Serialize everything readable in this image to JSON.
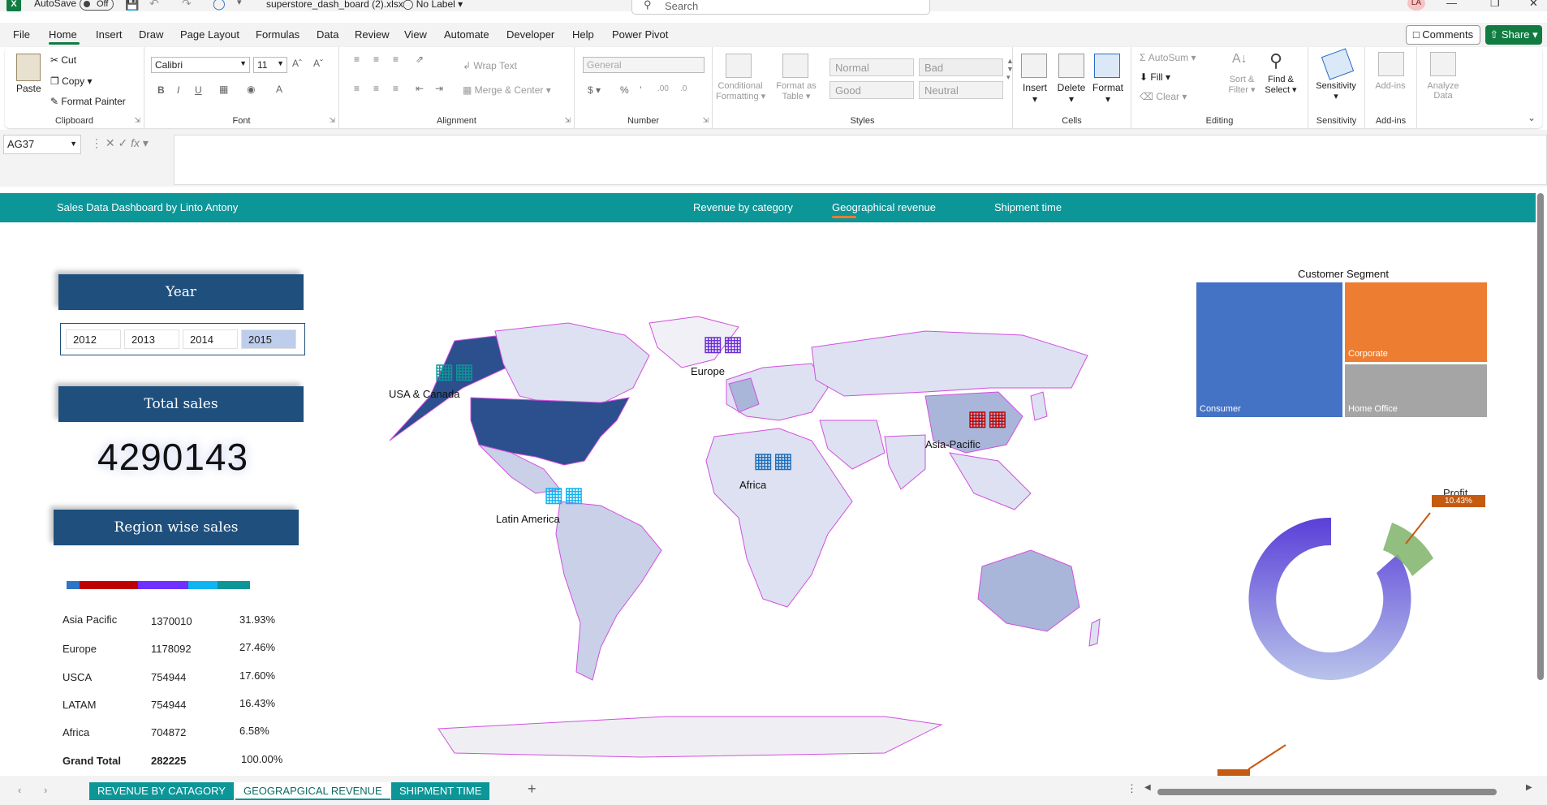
{
  "titlebar": {
    "autosave_label": "AutoSave",
    "autosave_state": "Off",
    "filename": "superstore_dash_board (2).xlsx",
    "sensitivity_label": "No Label",
    "search_placeholder": "Search",
    "user_initials": "LA"
  },
  "menu": {
    "items": [
      "File",
      "Home",
      "Insert",
      "Draw",
      "Page Layout",
      "Formulas",
      "Data",
      "Review",
      "View",
      "Automate",
      "Developer",
      "Help",
      "Power Pivot"
    ],
    "active": "Home",
    "comments": "Comments",
    "share": "Share"
  },
  "ribbon": {
    "clipboard": {
      "paste": "Paste",
      "cut": "Cut",
      "copy": "Copy",
      "format_painter": "Format Painter",
      "label": "Clipboard"
    },
    "font": {
      "name": "Calibri",
      "size": "11",
      "label": "Font"
    },
    "alignment": {
      "wrap": "Wrap Text",
      "merge": "Merge & Center",
      "label": "Alignment"
    },
    "number": {
      "format": "General",
      "label": "Number"
    },
    "styles": {
      "conditional": "Conditional",
      "conditional2": "Formatting",
      "format_as": "Format as",
      "format_as2": "Table",
      "normal": "Normal",
      "bad": "Bad",
      "good": "Good",
      "neutral": "Neutral",
      "label": "Styles"
    },
    "cells": {
      "insert": "Insert",
      "delete": "Delete",
      "format": "Format",
      "label": "Cells"
    },
    "editing": {
      "autosum": "AutoSum",
      "fill": "Fill",
      "clear": "Clear",
      "sort": "Sort &",
      "sort2": "Filter",
      "find": "Find &",
      "find2": "Select",
      "label": "Editing"
    },
    "sensitivity": {
      "btn": "Sensitivity",
      "label": "Sensitivity"
    },
    "addins": {
      "btn": "Add-ins",
      "label": "Add-ins"
    },
    "analyze": {
      "btn": "Analyze",
      "btn2": "Data"
    }
  },
  "formula": {
    "namebox": "AG37",
    "fx": "fx"
  },
  "dashboard": {
    "title": "Sales Data Dashboard by Linto Antony",
    "nav": [
      "Revenue by category",
      "Geographical revenue",
      "Shipment time"
    ],
    "year_header": "Year",
    "years": [
      "2012",
      "2013",
      "2014",
      "2015"
    ],
    "selected_year": "2015",
    "total_header": "Total sales",
    "total_value": "4290143",
    "region_header": "Region wise sales",
    "region_bar_colors": [
      "#2e74c9",
      "#c00000",
      "#7030ff",
      "#10b4f0",
      "#0d9698"
    ],
    "regions": [
      {
        "name": "Asia Pacific",
        "value": "1370010",
        "pct": "31.93%"
      },
      {
        "name": "Europe",
        "value": "1178092",
        "pct": "27.46%"
      },
      {
        "name": "USCA",
        "value": "754944",
        "pct": "17.60%"
      },
      {
        "name": "LATAM",
        "value": "754944",
        "pct": "16.43%"
      },
      {
        "name": "Africa",
        "value": "704872",
        "pct": "6.58%"
      }
    ],
    "grand_total": {
      "name": "Grand Total",
      "value": "282225",
      "pct": "100.00%"
    },
    "map_labels": [
      "USA & Canada",
      "Europe",
      "Asia-Pacific",
      "Africa",
      "Latin America"
    ],
    "treemap": {
      "title": "Customer Segment",
      "consumer": "Consumer",
      "corporate": "Corporate",
      "home_office": "Home Office",
      "colors": {
        "consumer": "#4472c4",
        "corporate": "#ed7d31",
        "home_office": "#a5a5a5"
      }
    },
    "profit": {
      "title": "Profit",
      "pct": "10.43%"
    }
  },
  "tabs": [
    "REVENUE BY CATAGORY",
    "GEOGRAPGICAL REVENUE",
    "SHIPMENT TIME"
  ],
  "active_tab": "GEOGRAPGICAL REVENUE"
}
